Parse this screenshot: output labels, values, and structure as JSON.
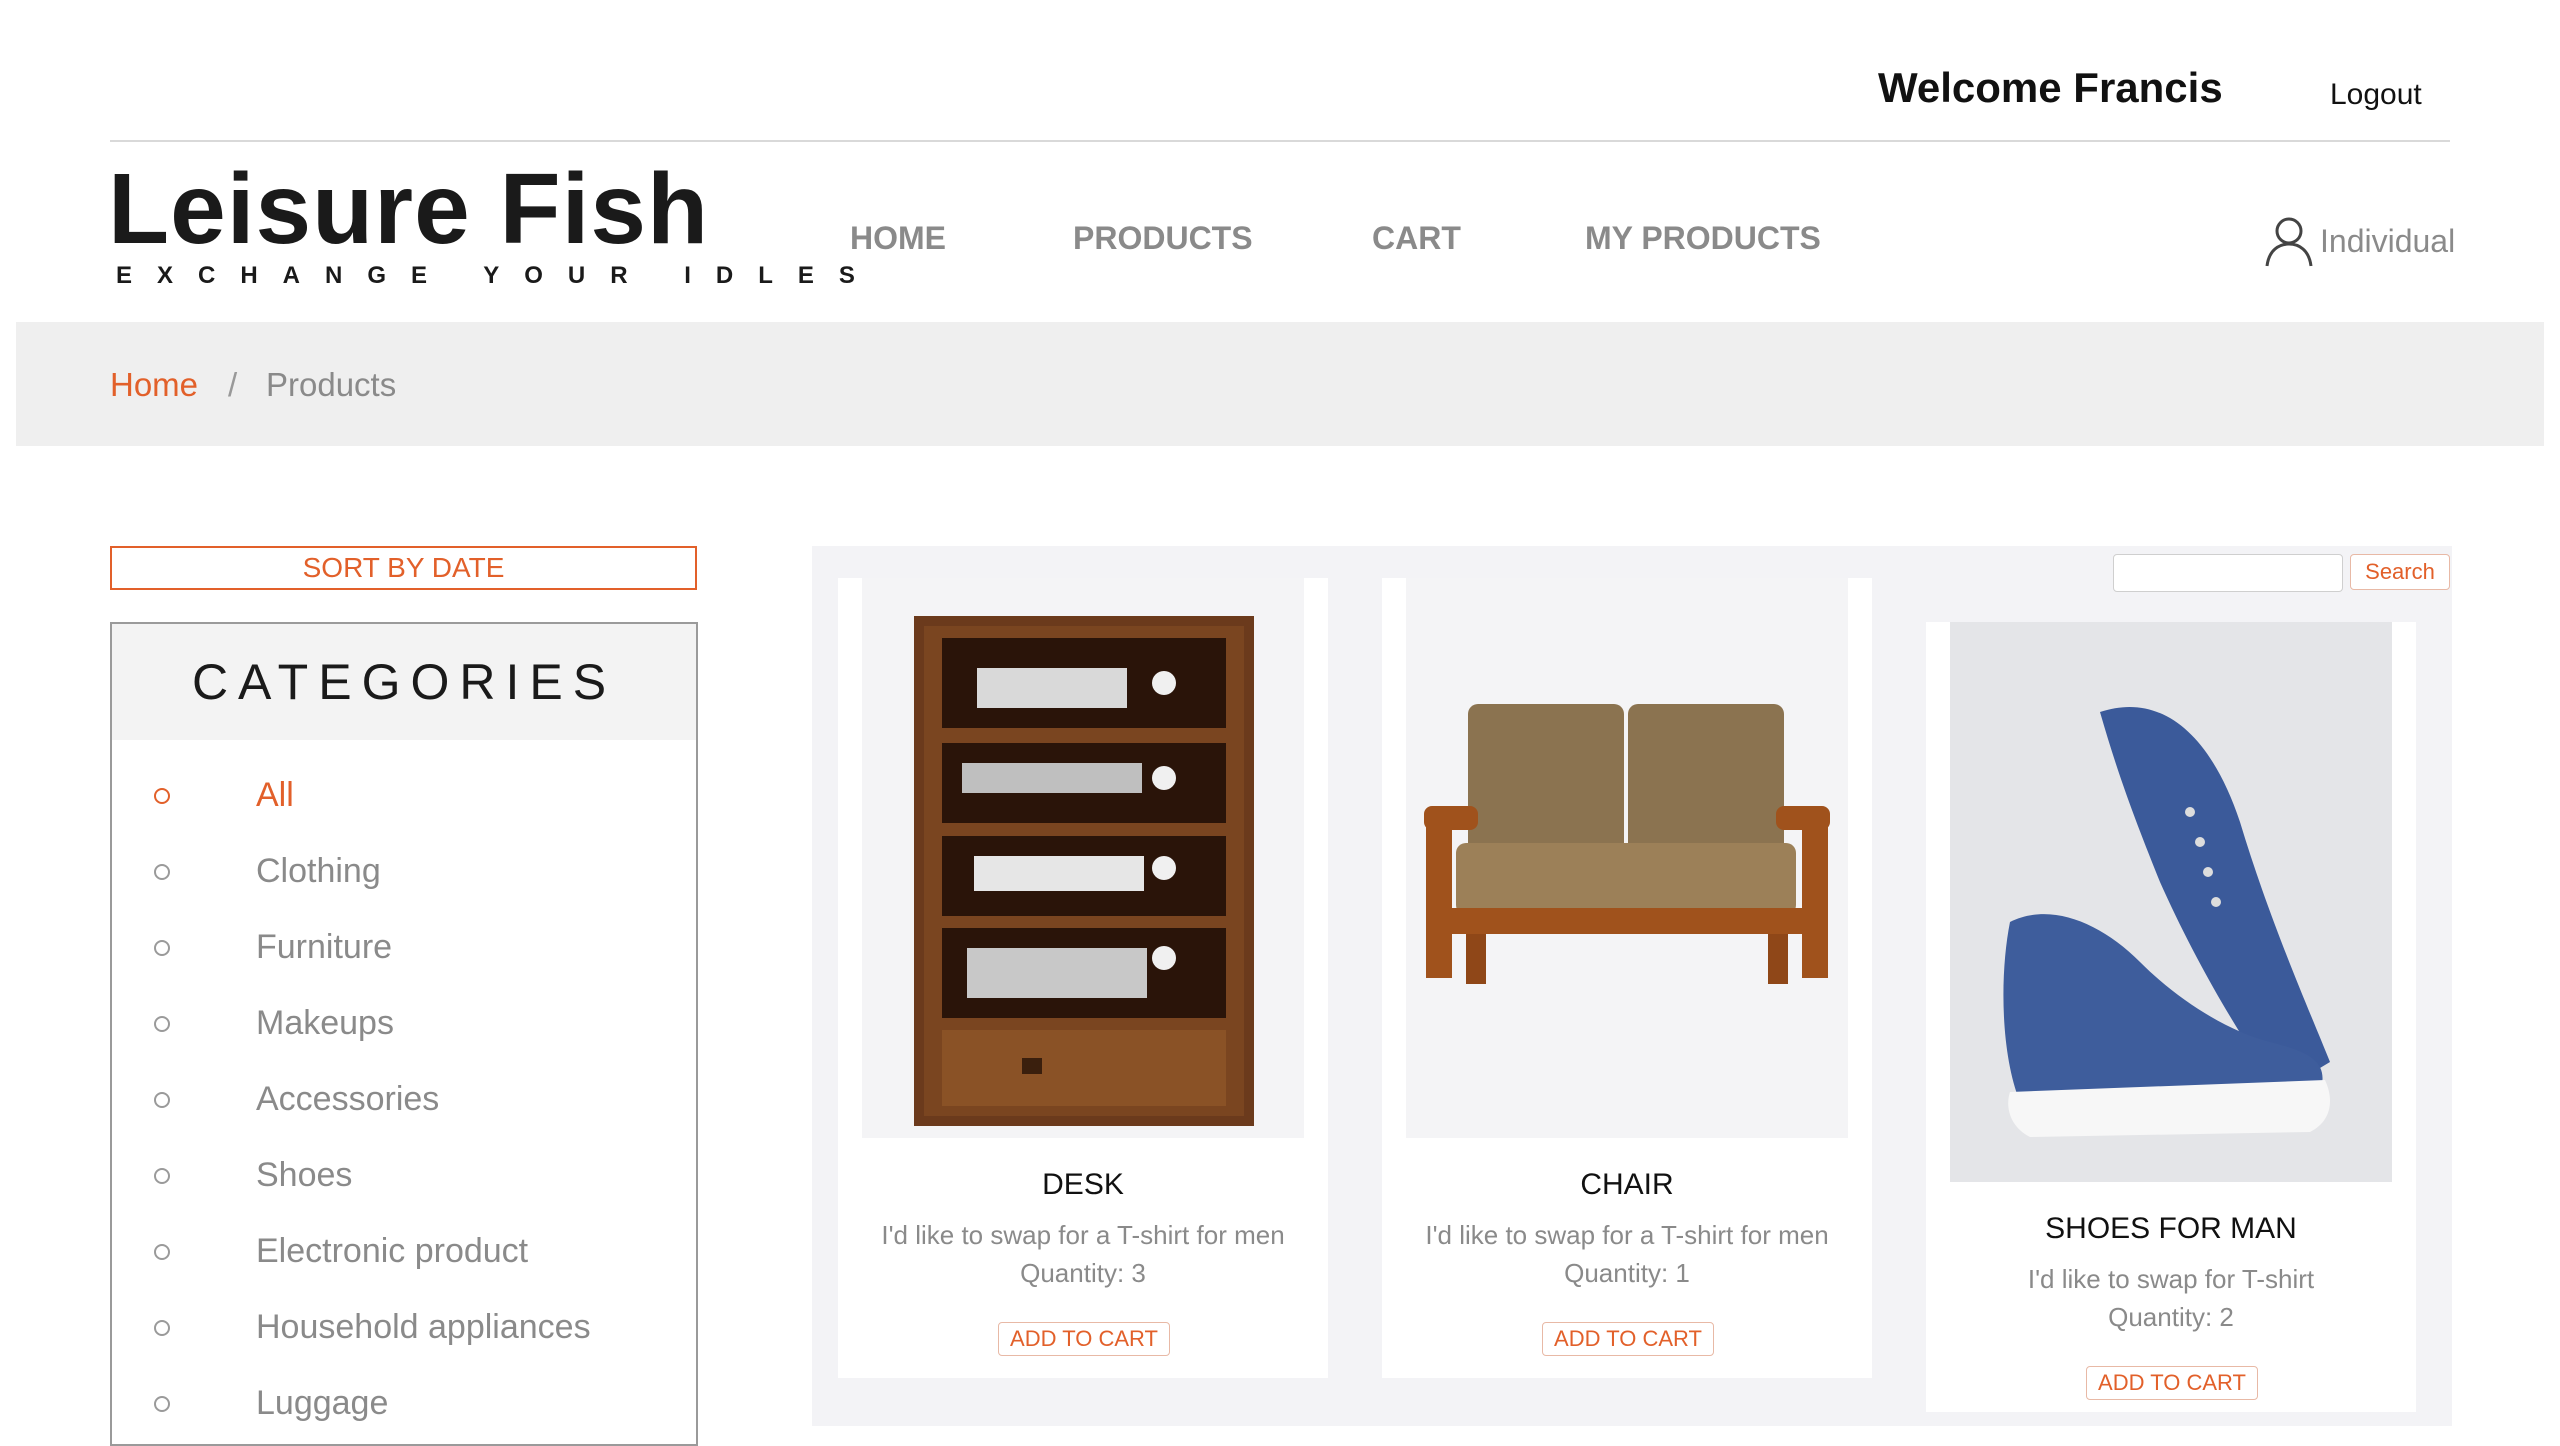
{
  "header": {
    "welcome": "Welcome Francis",
    "logout": "Logout",
    "logo_title": "Leisure Fish",
    "logo_subtitle": "EXCHANGE YOUR IDLES",
    "nav": [
      "HOME",
      "PRODUCTS",
      "CART",
      "MY PRODUCTS"
    ],
    "account_label": "Individual",
    "account_icon": "user-icon"
  },
  "breadcrumb": {
    "home": "Home",
    "separator": "/",
    "current": "Products"
  },
  "sidebar": {
    "sort_label": "SORT BY DATE",
    "categories_title": "CATEGORIES",
    "categories": [
      "All",
      "Clothing",
      "Furniture",
      "Makeups",
      "Accessories",
      "Shoes",
      "Electronic product",
      "Household appliances",
      "Luggage"
    ],
    "active_category": "All"
  },
  "search": {
    "value": "",
    "button": "Search"
  },
  "products": [
    {
      "title": "DESK",
      "desc": "I'd like to swap for a T-shirt for men",
      "quantity": "Quantity: 3",
      "add": "ADD TO CART",
      "image_icon": "desk-shelf-image"
    },
    {
      "title": "CHAIR",
      "desc": "I'd like to swap for a T-shirt for men",
      "quantity": "Quantity: 1",
      "add": "ADD TO CART",
      "image_icon": "sofa-chair-image"
    },
    {
      "title": "SHOES FOR MAN",
      "desc": "I'd like to swap for T-shirt",
      "quantity": "Quantity: 2",
      "add": "ADD TO CART",
      "image_icon": "sneaker-image"
    }
  ],
  "colors": {
    "accent": "#e2602a",
    "muted_text": "#8a8a8a",
    "panel_bg": "#f3f3f6"
  }
}
